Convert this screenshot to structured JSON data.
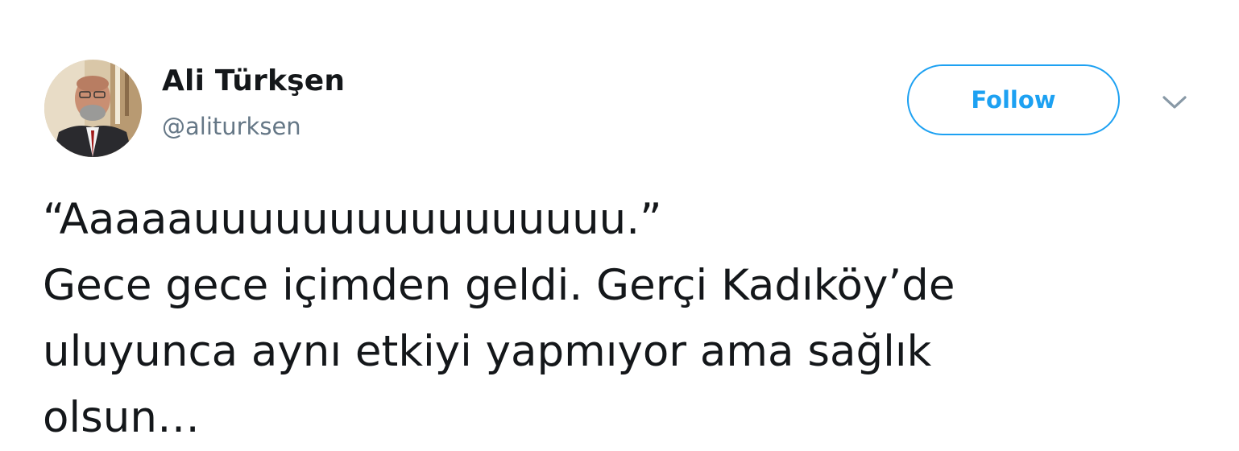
{
  "user": {
    "display_name": "Ali Türkşen",
    "handle": "@aliturksen",
    "avatar_icon": "profile-photo"
  },
  "actions": {
    "follow_label": "Follow",
    "more_icon": "chevron-down-icon"
  },
  "tweet": {
    "lines": [
      "“Aaaaauuuuuuuuuuuuuuuu.”",
      "Gece gece içimden geldi. Gerçi Kadıköy’de",
      "uluyunca aynı etkiyi yapmıyor ama sağlık",
      "olsun…"
    ]
  },
  "colors": {
    "accent": "#1da1f2",
    "text": "#14171a",
    "secondary_text": "#657786"
  }
}
